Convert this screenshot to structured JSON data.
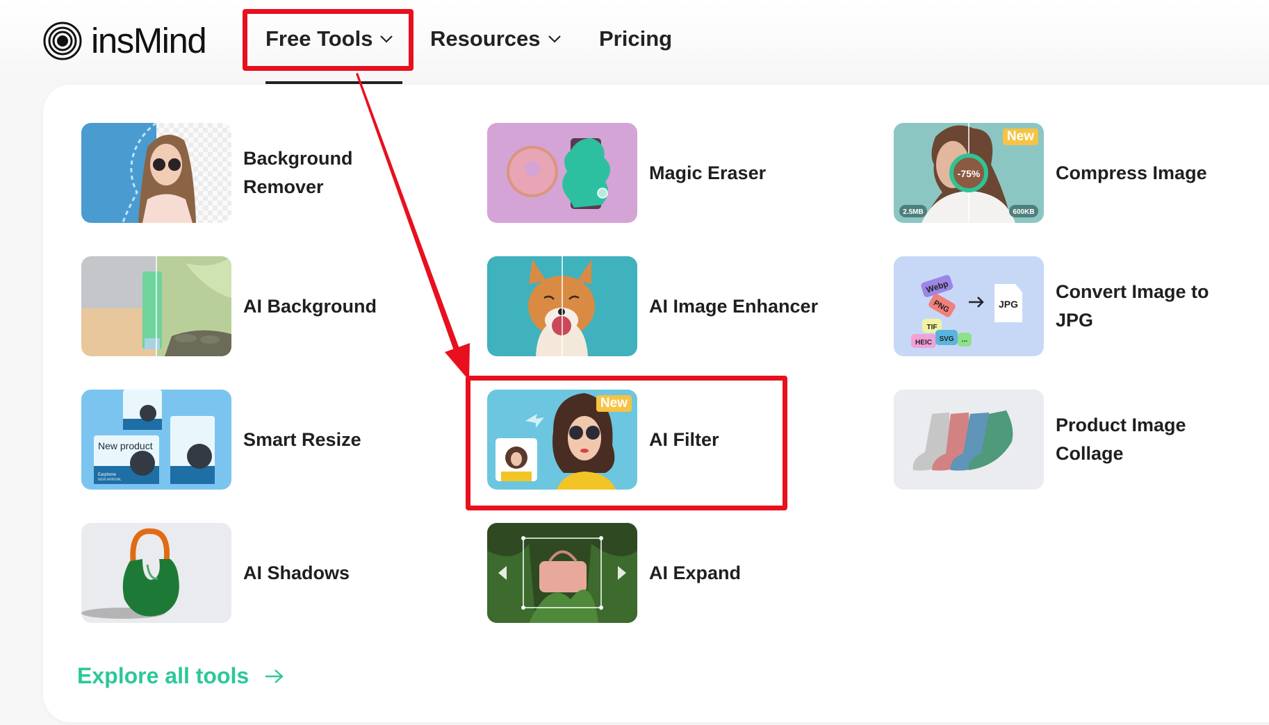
{
  "header": {
    "logo_text": "insMind",
    "nav": [
      {
        "label": "Free Tools",
        "has_dropdown": true,
        "active": true
      },
      {
        "label": "Resources",
        "has_dropdown": true,
        "active": false
      },
      {
        "label": "Pricing",
        "has_dropdown": false,
        "active": false
      }
    ]
  },
  "tools": [
    {
      "label": "Background Remover",
      "icon": "background-remover-thumbnail",
      "badge": null
    },
    {
      "label": "Magic Eraser",
      "icon": "magic-eraser-thumbnail",
      "badge": null
    },
    {
      "label": "Compress Image",
      "icon": "compress-image-thumbnail",
      "badge": "New",
      "thumb_text": {
        "percent": "-75%",
        "before": "2.5MB",
        "after": "600KB"
      }
    },
    {
      "label": "AI Background",
      "icon": "ai-background-thumbnail",
      "badge": null
    },
    {
      "label": "AI Image Enhancer",
      "icon": "ai-image-enhancer-thumbnail",
      "badge": null
    },
    {
      "label": "Convert Image to JPG",
      "icon": "convert-to-jpg-thumbnail",
      "badge": null,
      "thumb_text": {
        "formats": [
          "Webp",
          "PNG",
          "TIF",
          "HEIC",
          "SVG",
          "..."
        ],
        "target": "JPG"
      }
    },
    {
      "label": "Smart Resize",
      "icon": "smart-resize-thumbnail",
      "badge": null,
      "thumb_text": {
        "headline": "New product",
        "sub": "Earphone",
        "sub2": "NEW ARRIVAL"
      }
    },
    {
      "label": "AI Filter",
      "icon": "ai-filter-thumbnail",
      "badge": "New"
    },
    {
      "label": "Product Image Collage",
      "icon": "product-collage-thumbnail",
      "badge": null
    },
    {
      "label": "AI Shadows",
      "icon": "ai-shadows-thumbnail",
      "badge": null
    },
    {
      "label": "AI Expand",
      "icon": "ai-expand-thumbnail",
      "badge": null
    }
  ],
  "explore_link": {
    "label": "Explore all tools"
  },
  "annotations": {
    "highlight_color": "#e8101e",
    "highlighted": [
      "Free Tools",
      "AI Filter"
    ]
  },
  "colors": {
    "accent": "#2cc79a",
    "badge": "#f6c343",
    "text": "#1f1f1f"
  }
}
